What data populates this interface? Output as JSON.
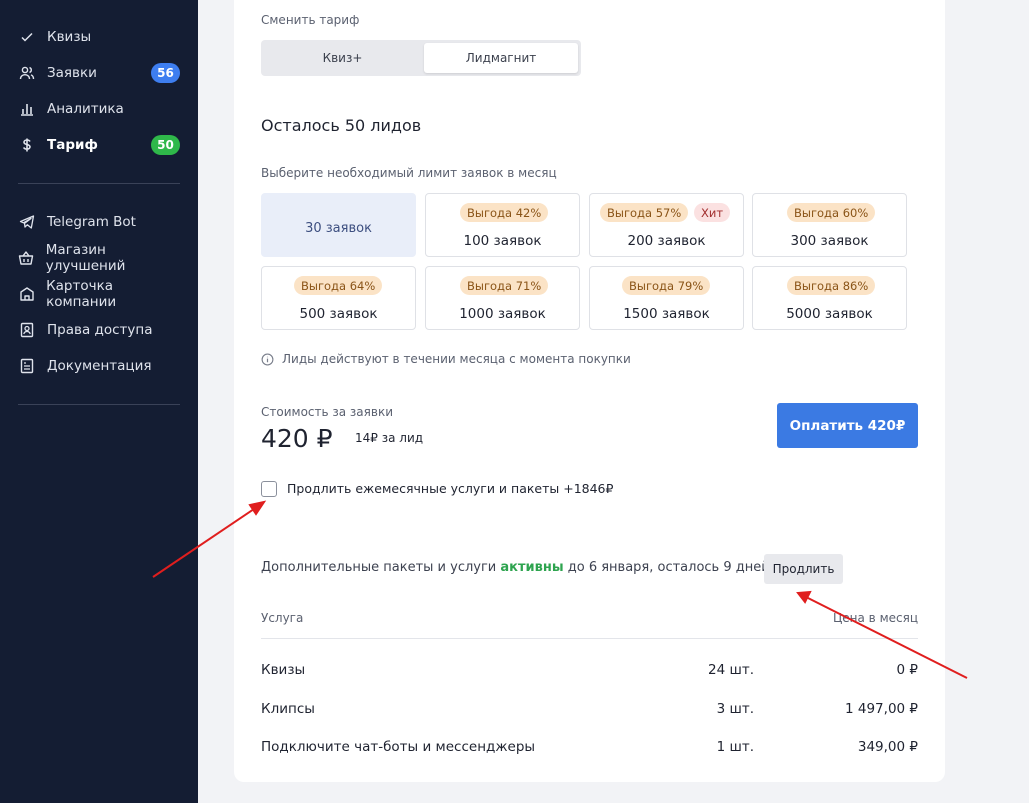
{
  "sidebar": {
    "items": [
      {
        "label": "Квизы",
        "icon": "check-icon"
      },
      {
        "label": "Заявки",
        "icon": "users-icon",
        "badge": "56"
      },
      {
        "label": "Аналитика",
        "icon": "bar-chart-icon"
      },
      {
        "label": "Тариф",
        "icon": "dollar-icon",
        "badge": "50",
        "active": true
      },
      {
        "label": "Telegram Bot",
        "icon": "telegram-icon"
      },
      {
        "label": "Магазин улучшений",
        "icon": "basket-icon"
      },
      {
        "label": "Карточка компании",
        "icon": "building-icon"
      },
      {
        "label": "Права доступа",
        "icon": "user-card-icon"
      },
      {
        "label": "Документация",
        "icon": "document-icon"
      }
    ]
  },
  "tariff": {
    "switch_label": "Сменить тариф",
    "options": [
      "Квиз+",
      "Лидмагнит"
    ],
    "selected_option": "Лидмагнит"
  },
  "leads": {
    "remaining_title": "Осталось 50 лидов",
    "limit_label": "Выберите необходимый лимит заявок в месяц",
    "packages": [
      {
        "amount": "30 заявок",
        "selected": true
      },
      {
        "amount": "100 заявок",
        "save": "Выгода 42%"
      },
      {
        "amount": "200 заявок",
        "save": "Выгода 57%",
        "hit": "Хит"
      },
      {
        "amount": "300 заявок",
        "save": "Выгода 60%"
      },
      {
        "amount": "500 заявок",
        "save": "Выгода 64%"
      },
      {
        "amount": "1000 заявок",
        "save": "Выгода 71%"
      },
      {
        "amount": "1500 заявок",
        "save": "Выгода 79%"
      },
      {
        "amount": "5000 заявок",
        "save": "Выгода 86%"
      }
    ],
    "info_note": "Лиды действуют в течении месяца с момента покупки"
  },
  "cost": {
    "label": "Стоимость за заявки",
    "value": "420 ₽",
    "per_lead": "14₽ за лид",
    "pay_button": "Оплатить 420₽"
  },
  "renew_option": {
    "checked": false,
    "label": "Продлить ежемесячные услуги и пакеты +1846₽"
  },
  "extras": {
    "text_before": "Дополнительные пакеты и услуги ",
    "status": "активны",
    "text_after": " до 6 января, осталось 9 дней",
    "renew_button": "Продлить",
    "col_service": "Услуга",
    "col_price": "Цена в месяц",
    "rows": [
      {
        "service": "Квизы",
        "qty": "24 шт.",
        "price": "0 ₽"
      },
      {
        "service": "Клипсы",
        "qty": "3 шт.",
        "price": "1 497,00 ₽"
      },
      {
        "service": "Подключите чат-боты и мессенджеры",
        "qty": "1 шт.",
        "price": "349,00 ₽"
      }
    ]
  },
  "colors": {
    "sidebar_bg": "#141d33",
    "accent_blue": "#3b7ae3",
    "active_green": "#2ea44f",
    "badge_blue": "#3e7ef0",
    "badge_green": "#2fb84a",
    "annotation_red": "#e01e1e"
  }
}
